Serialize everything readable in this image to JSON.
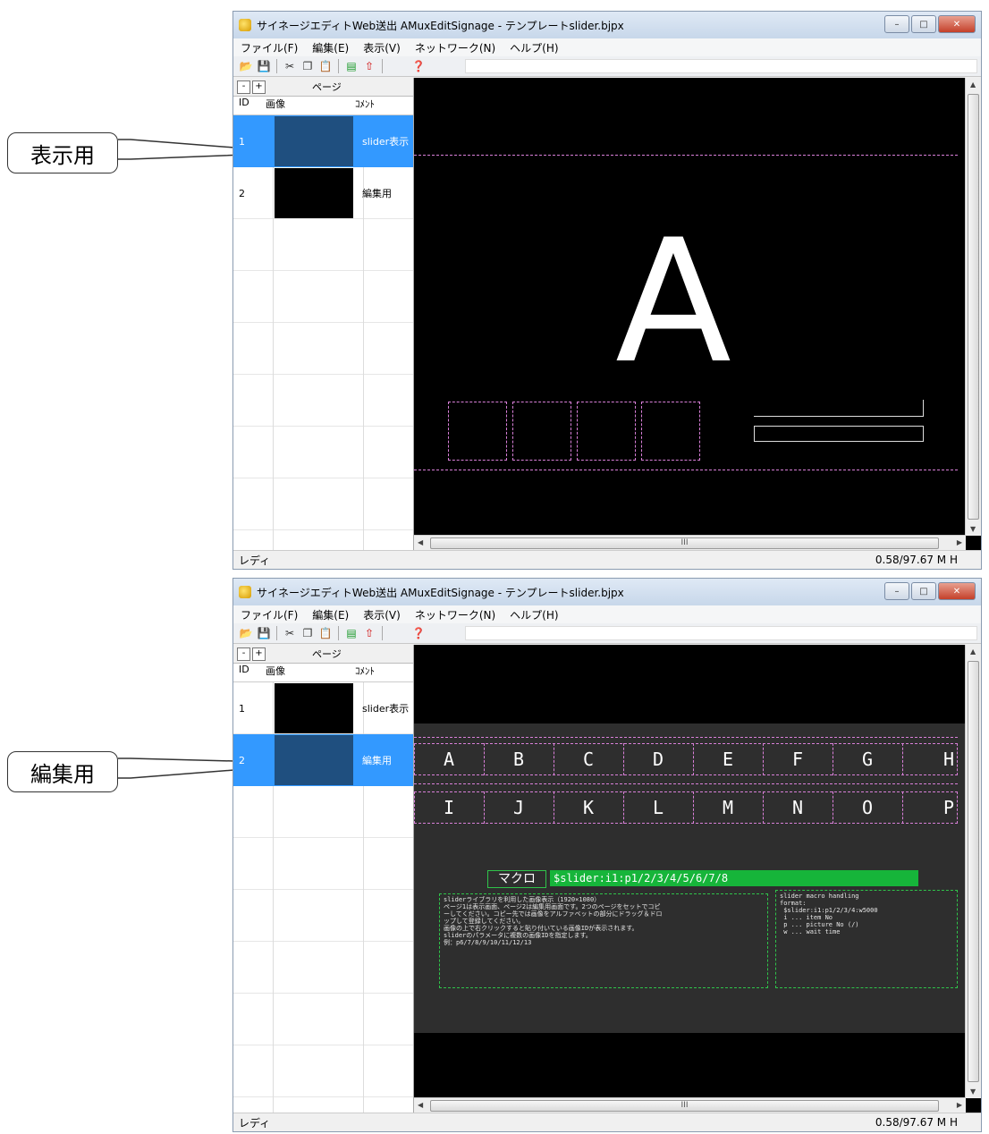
{
  "callouts": {
    "top": "表示用",
    "bottom": "編集用"
  },
  "window": {
    "title": "サイネージエディトWeb送出 AMuxEditSignage - テンプレートslider.bjpx",
    "menu": [
      "ファイル(F)",
      "編集(E)",
      "表示(V)",
      "ネットワーク(N)",
      "ヘルプ(H)"
    ],
    "status_text": "レディ",
    "status_right": "0.58/97.67 M  H",
    "page_panel_title": "ページ",
    "page_add": "+",
    "page_remove": "-",
    "columns": {
      "id": "ID",
      "image": "画像",
      "comment": "ｺﾒﾝﾄ"
    },
    "pages": [
      {
        "id": "1",
        "comment": "slider表示"
      },
      {
        "id": "2",
        "comment": "編集用"
      }
    ],
    "scroll_grip": "III"
  },
  "window1": {
    "selected_page": "1"
  },
  "window2": {
    "selected_page": "2"
  },
  "preview1": {
    "big_letter": "A"
  },
  "preview2": {
    "letters_row1": [
      "A",
      "B",
      "C",
      "D",
      "E",
      "F",
      "G",
      "H"
    ],
    "letters_row2": [
      "I",
      "J",
      "K",
      "L",
      "M",
      "N",
      "O",
      "P"
    ],
    "macro_label": "マクロ",
    "macro_value": "$slider:i1:p1/2/3/4/5/6/7/8",
    "note_left": "sliderライブラリを利用した画像表示（1920×1080）\nページ1は表示画面、ページ2は編集用画面です。2つのページをセットでコピ\nーしてください。コピー先では画像をアルファベットの部分にドラッグ＆ドロ\nップして登録してください。\n画像の上で右クリックすると貼り付いている画像IDが表示されます。\nsliderのパラメータに複数の画像IDを指定します。\n例：p6/7/8/9/10/11/12/13",
    "note_right": "slider macro handling\nformat:\n $slider:i1:p1/2/3/4:w5000\n i ... item No\n p ... picture No (/)\n w ... wait time"
  }
}
